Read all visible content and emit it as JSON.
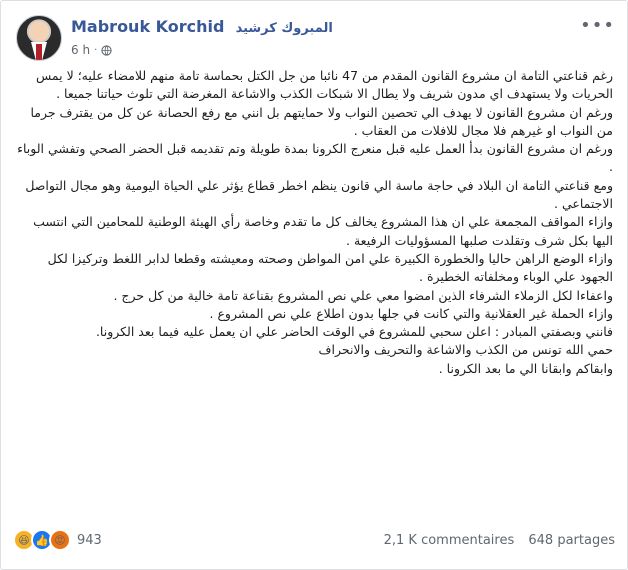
{
  "post": {
    "author_name": "Mabrouk Korchid",
    "author_name_ar": "المبروك كرشيد",
    "time": "6 h",
    "privacy_icon": "globe-icon",
    "paragraphs": [
      "رغم قناعتي التامة ان مشروع القانون المقدم من 47 نائبا من جل الكتل بحماسة تامة منهم للامضاء عليه؛ لا يمس الحريات ولا يستهدف اي مدون شريف ولا يطال الا شبكات الكذب والاشاعة المغرضة التي تلوث حياتنا جميعا .",
      "ورغم ان مشروع القانون لا يهدف الي تحصين النواب ولا حمايتهم بل انني مع رفع الحصانة عن كل من يقترف جرما من النواب او غيرهم فلا مجال للافلات من العقاب .",
      "ورغم ان مشروع القانون بدأ العمل عليه قبل منعرج الكرونا بمدة طويلة وتم تقديمه قبل الحضر الصحي وتفشي الوباء .",
      "ومع قناعتي التامة ان البلاد في حاجة ماسة الي قانون ينظم اخطر قطاع يؤثر علي الحياة اليومية وهو مجال التواصل الاجتماعي .",
      "وازاء المواقف المجمعة علي ان هذا المشروع يخالف كل ما تقدم وخاصة رأي الهيئة الوطنية للمحامين التي انتسب اليها بكل شرف وتقلدت صلبها المسؤوليات الرفيعة .",
      "وازاء الوضع الراهن حاليا والخطورة الكبيرة علي امن المواطن وصحته ومعيشته وقطعا لدابر اللغط وتركيزا لكل الجهود علي الوباء ومخلفاته الخطيرة .",
      "واعفاءا لكل الزملاء الشرفاء الذين امضوا معي علي نص المشروع بقناعة تامة خالية من كل حرج .",
      "وازاء الحملة غير العقلانية والتي كانت في جلها بدون اطلاع علي نص المشروع .",
      "فانني وبصفتي المبادر : اعلن سحبي للمشروع في الوقت الحاضر علي ان يعمل عليه فيما بعد الكرونا.",
      "حمي الله تونس من الكذب والاشاعة والتحريف والانحراف",
      "وابقاكم وابقانا الي ما بعد الكرونا ."
    ]
  },
  "footer": {
    "reaction_icons": [
      "haha-icon",
      "like-icon",
      "angry-icon"
    ],
    "reaction_count": "943",
    "comments": "2,1 K commentaires",
    "shares": "648 partages"
  }
}
